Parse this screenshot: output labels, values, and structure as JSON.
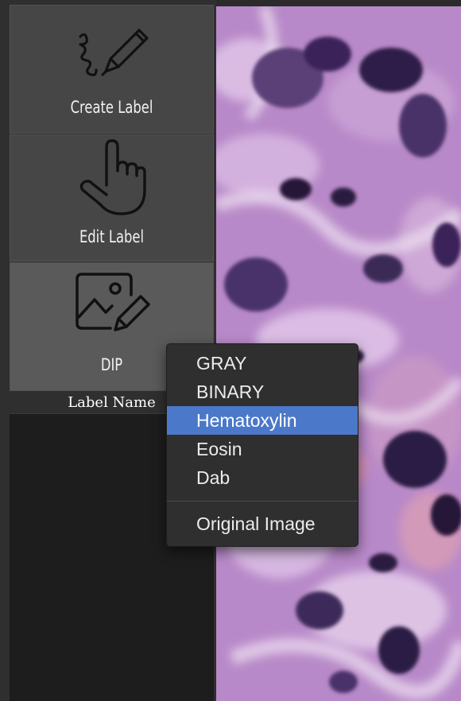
{
  "sidebar": {
    "tools": [
      {
        "label": "Create Label",
        "icon": "pen-scribble-icon"
      },
      {
        "label": "Edit Label",
        "icon": "pointing-hand-icon"
      },
      {
        "label": "DIP",
        "icon": "image-edit-icon",
        "active": true
      }
    ],
    "label_name_heading": "Label Name"
  },
  "context_menu": {
    "items": [
      "GRAY",
      "BINARY",
      "Hematoxylin",
      "Eosin",
      "Dab"
    ],
    "selected": "Hematoxylin",
    "footer_item": "Original Image"
  },
  "colors": {
    "selection": "#4c78c9",
    "stain_purple": "#a06ab0",
    "nucleus": "#2a1a45"
  }
}
